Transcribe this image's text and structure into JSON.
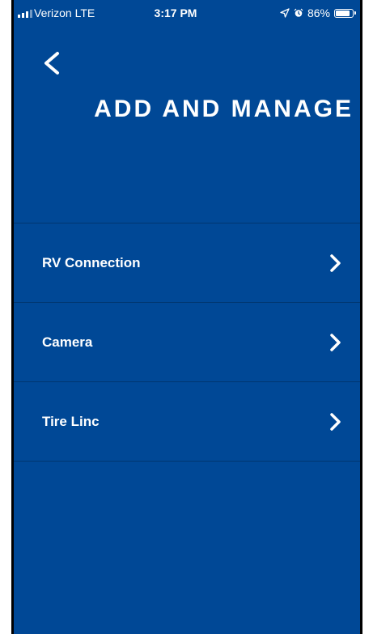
{
  "status_bar": {
    "carrier": "Verizon  LTE",
    "time": "3:17 PM",
    "battery_text": "86%",
    "battery_level": 0.86,
    "icons": [
      "signal-icon",
      "location-icon",
      "alarm-icon",
      "battery-icon"
    ]
  },
  "header": {
    "back_icon": "chevron-left-icon",
    "title": "ADD AND MANAGE"
  },
  "menu": {
    "items": [
      {
        "label": "RV Connection",
        "icon": "chevron-right-icon"
      },
      {
        "label": "Camera",
        "icon": "chevron-right-icon"
      },
      {
        "label": "Tire Linc",
        "icon": "chevron-right-icon"
      }
    ]
  },
  "colors": {
    "background": "#004896",
    "text": "#ffffff"
  }
}
